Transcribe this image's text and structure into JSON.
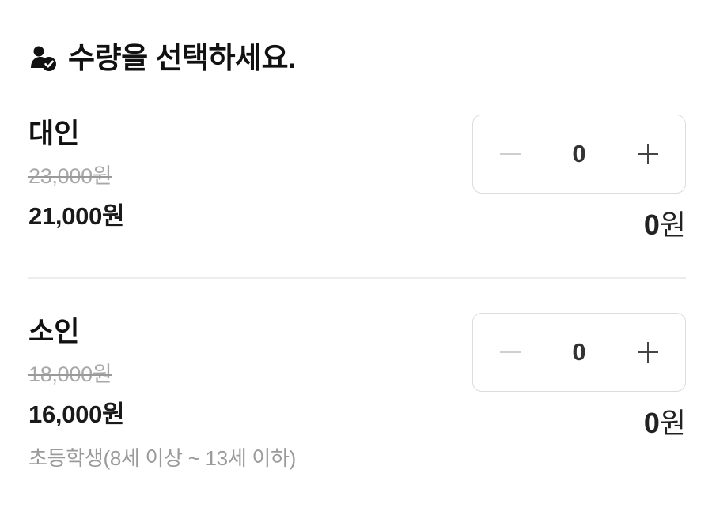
{
  "header": {
    "title": "수량을 선택하세요."
  },
  "items": [
    {
      "name": "대인",
      "original_price": "23,000원",
      "price": "21,000원",
      "quantity": "0",
      "subtotal_number": "0",
      "subtotal_unit": "원"
    },
    {
      "name": "소인",
      "original_price": "18,000원",
      "price": "16,000원",
      "quantity": "0",
      "subtotal_number": "0",
      "subtotal_unit": "원",
      "note": "초등학생(8세 이상 ~ 13세 이하)"
    }
  ],
  "icons": {
    "header": "user-check-icon",
    "decrement": "minus-icon",
    "increment": "plus-icon"
  },
  "colors": {
    "text_primary": "#111111",
    "text_muted": "#a8a8a8",
    "border": "#dcdcdc",
    "divider": "#ececec",
    "minus_disabled": "#cfcfcf",
    "plus_active": "#444444"
  }
}
